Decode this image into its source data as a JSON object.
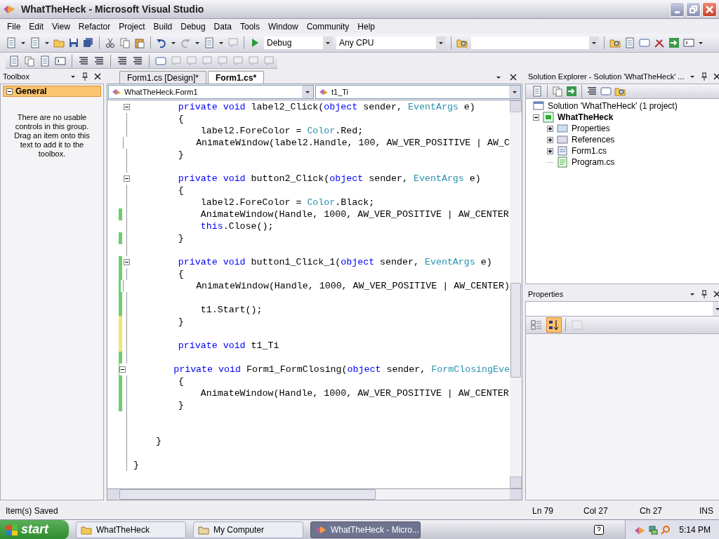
{
  "window": {
    "title": "WhatTheHeck - Microsoft Visual Studio"
  },
  "menu": [
    "File",
    "Edit",
    "View",
    "Refactor",
    "Project",
    "Build",
    "Debug",
    "Data",
    "Tools",
    "Window",
    "Community",
    "Help"
  ],
  "toolbar": {
    "configuration": "Debug",
    "platform": "Any CPU"
  },
  "toolbox": {
    "title": "Toolbox",
    "groups": [
      {
        "label": "General",
        "selected": true,
        "expanded": true
      }
    ],
    "message": "There are no usable controls in this group. Drag an item onto this text to add it to the toolbox."
  },
  "editor": {
    "tabs": [
      {
        "label": "Form1.cs [Design]*",
        "selected": false
      },
      {
        "label": "Form1.cs*",
        "selected": true
      }
    ],
    "type_dropdown": "WhatTheHeck.Form1",
    "member_dropdown": "t1_Ti",
    "lines": [
      {
        "modified": false,
        "fold": true,
        "tokens": [
          {
            "kind": "keyword",
            "text": "        private void"
          },
          {
            "kind": "plain",
            "text": " label2_Click("
          },
          {
            "kind": "keyword",
            "text": "object"
          },
          {
            "kind": "plain",
            "text": " sender, "
          },
          {
            "kind": "type",
            "text": "EventArgs"
          },
          {
            "kind": "plain",
            "text": " e)"
          }
        ]
      },
      {
        "modified": false,
        "fold": false,
        "tokens": [
          {
            "kind": "plain",
            "text": "        {"
          }
        ]
      },
      {
        "modified": false,
        "fold": false,
        "tokens": [
          {
            "kind": "plain",
            "text": "            label2.ForeColor = "
          },
          {
            "kind": "type",
            "text": "Color"
          },
          {
            "kind": "plain",
            "text": ".Red;"
          }
        ]
      },
      {
        "modified": false,
        "fold": false,
        "tokens": [
          {
            "kind": "plain",
            "text": "            AnimateWindow(label2.Handle, 100, AW_VER_POSITIVE | AW_C"
          }
        ]
      },
      {
        "modified": false,
        "fold": false,
        "tokens": [
          {
            "kind": "plain",
            "text": "        }"
          }
        ]
      },
      {
        "modified": false,
        "fold": false
      },
      {
        "modified": false,
        "fold": true,
        "tokens": [
          {
            "kind": "keyword",
            "text": "        private void"
          },
          {
            "kind": "plain",
            "text": " button2_Click("
          },
          {
            "kind": "keyword",
            "text": "object"
          },
          {
            "kind": "plain",
            "text": " sender, "
          },
          {
            "kind": "type",
            "text": "EventArgs"
          },
          {
            "kind": "plain",
            "text": " e)"
          }
        ]
      },
      {
        "modified": false,
        "fold": false,
        "tokens": [
          {
            "kind": "plain",
            "text": "        {"
          }
        ]
      },
      {
        "modified": false,
        "fold": false,
        "tokens": [
          {
            "kind": "plain",
            "text": "            label2.ForeColor = "
          },
          {
            "kind": "type",
            "text": "Color"
          },
          {
            "kind": "plain",
            "text": ".Black;"
          }
        ]
      },
      {
        "modified": true,
        "saved": true,
        "fold": false,
        "tokens": [
          {
            "kind": "plain",
            "text": "            AnimateWindow(Handle, 1000, AW_VER_POSITIVE | AW_CENTER"
          }
        ]
      },
      {
        "modified": false,
        "fold": false,
        "tokens": [
          {
            "kind": "keyword",
            "text": "            this"
          },
          {
            "kind": "plain",
            "text": ".Close();"
          }
        ]
      },
      {
        "modified": true,
        "saved": true,
        "fold": false,
        "tokens": [
          {
            "kind": "plain",
            "text": "        }"
          }
        ]
      },
      {
        "modified": false,
        "fold": false
      },
      {
        "modified": true,
        "saved": true,
        "fold": true,
        "tokens": [
          {
            "kind": "keyword",
            "text": "        private void"
          },
          {
            "kind": "plain",
            "text": " button1_Click_1("
          },
          {
            "kind": "keyword",
            "text": "object"
          },
          {
            "kind": "plain",
            "text": " sender, "
          },
          {
            "kind": "type",
            "text": "EventArgs"
          },
          {
            "kind": "plain",
            "text": " e)"
          }
        ]
      },
      {
        "modified": true,
        "saved": true,
        "fold": false,
        "tokens": [
          {
            "kind": "plain",
            "text": "        {"
          }
        ]
      },
      {
        "modified": true,
        "saved": true,
        "fold": false,
        "tokens": [
          {
            "kind": "plain",
            "text": "            AnimateWindow(Handle, 1000, AW_VER_POSITIVE | AW_CENTER)"
          }
        ]
      },
      {
        "modified": true,
        "saved": true,
        "fold": false
      },
      {
        "modified": true,
        "saved": true,
        "fold": false,
        "tokens": [
          {
            "kind": "plain",
            "text": "            t1.Start();"
          }
        ]
      },
      {
        "modified": true,
        "saved": false,
        "fold": false,
        "tokens": [
          {
            "kind": "plain",
            "text": "        }"
          }
        ]
      },
      {
        "modified": true,
        "saved": false,
        "fold": false
      },
      {
        "modified": true,
        "saved": false,
        "fold": false,
        "tokens": [
          {
            "kind": "keyword",
            "text": "        private void"
          },
          {
            "kind": "plain",
            "text": " t1_Ti"
          }
        ]
      },
      {
        "modified": true,
        "saved": true,
        "fold": false
      },
      {
        "modified": true,
        "saved": true,
        "fold": true,
        "tokens": [
          {
            "kind": "keyword",
            "text": "        private void"
          },
          {
            "kind": "plain",
            "text": " Form1_FormClosing("
          },
          {
            "kind": "keyword",
            "text": "object"
          },
          {
            "kind": "plain",
            "text": " sender, "
          },
          {
            "kind": "type",
            "text": "FormClosingEve"
          }
        ]
      },
      {
        "modified": true,
        "saved": true,
        "fold": false,
        "tokens": [
          {
            "kind": "plain",
            "text": "        {"
          }
        ]
      },
      {
        "modified": true,
        "saved": true,
        "fold": false,
        "tokens": [
          {
            "kind": "plain",
            "text": "            AnimateWindow(Handle, 1000, AW_VER_POSITIVE | AW_CENTER"
          }
        ]
      },
      {
        "modified": true,
        "saved": true,
        "fold": false,
        "tokens": [
          {
            "kind": "plain",
            "text": "        }"
          }
        ]
      },
      {
        "modified": false,
        "fold": false
      },
      {
        "modified": false,
        "fold": false
      },
      {
        "modified": false,
        "fold": false,
        "tokens": [
          {
            "kind": "plain",
            "text": "    }"
          }
        ]
      },
      {
        "modified": false,
        "fold": false
      },
      {
        "modified": false,
        "fold": false,
        "tokens": [
          {
            "kind": "plain",
            "text": "}"
          }
        ]
      }
    ]
  },
  "solution_explorer": {
    "title": "Solution Explorer - Solution 'WhatTheHeck' ...",
    "tree": [
      {
        "label": "Solution 'WhatTheHeck' (1 project)",
        "kind": "solution",
        "children": [
          {
            "label": "WhatTheHeck",
            "kind": "project",
            "expanded": true,
            "children": [
              {
                "label": "Properties",
                "kind": "properties",
                "expanded": false
              },
              {
                "label": "References",
                "kind": "references",
                "expanded": false
              },
              {
                "label": "Form1.cs",
                "kind": "form",
                "expanded": false
              },
              {
                "label": "Program.cs",
                "kind": "code"
              }
            ]
          }
        ]
      }
    ]
  },
  "properties": {
    "title": "Properties",
    "view_buttons": [
      {
        "kind": "categorized",
        "selected": false,
        "disabled": false
      },
      {
        "kind": "alphabetical",
        "selected": true,
        "disabled": false
      },
      {
        "kind": "pages",
        "selected": false,
        "disabled": true
      }
    ]
  },
  "status_bar": {
    "message": "Item(s) Saved",
    "line": "Ln 79",
    "column": "Col 27",
    "char": "Ch 27",
    "mode": "INS"
  },
  "taskbar": {
    "start": "start",
    "tasks": [
      {
        "label": "WhatTheHeck",
        "kind": "folder",
        "selected": false
      },
      {
        "label": "My Computer",
        "kind": "computer",
        "selected": false
      },
      {
        "label": "WhatTheHeck - Micro...",
        "kind": "app",
        "selected": true
      }
    ],
    "clock": "5:14 PM"
  }
}
